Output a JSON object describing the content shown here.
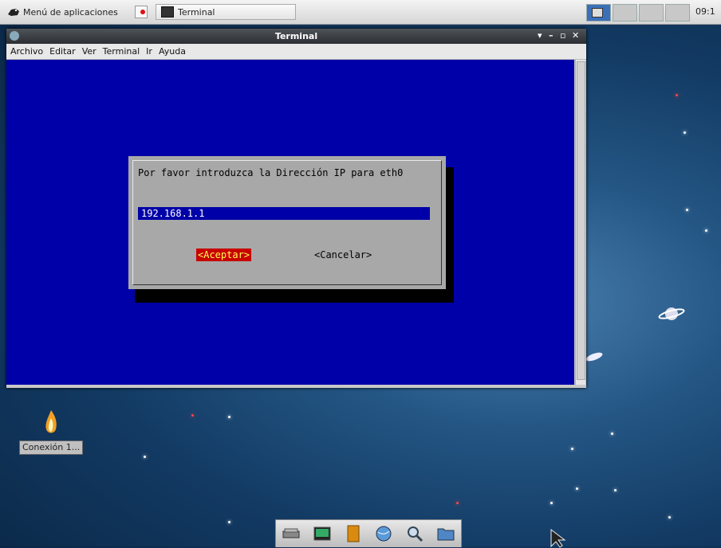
{
  "top_panel": {
    "app_menu_label": "Menú de aplicaciones",
    "taskbar_window": "Terminal",
    "clock": "09:1"
  },
  "window": {
    "title": "Terminal",
    "controls": [
      "▾",
      "–",
      "▫",
      "✕"
    ],
    "menus": [
      "Archivo",
      "Editar",
      "Ver",
      "Terminal",
      "Ir",
      "Ayuda"
    ]
  },
  "dialog": {
    "prompt": "Por favor introduzca la Dirección IP para eth0",
    "input_value": "192.168.1.1",
    "ok_label": "<Aceptar>",
    "cancel_label": "<Cancelar>"
  },
  "desktop": {
    "icon_label": "Conexión 1...",
    "icons": [
      "flame-icon",
      "planet-icon"
    ]
  },
  "dock": {
    "icons": [
      "drive-icon",
      "terminal-icon",
      "book-icon",
      "globe-icon",
      "search-icon",
      "folder-icon"
    ]
  },
  "colors": {
    "terminal_bg": "#0000a8",
    "dialog_bg": "#a8a8a8",
    "ok_button_bg": "#c80000",
    "ok_button_fg": "#ffff55"
  }
}
